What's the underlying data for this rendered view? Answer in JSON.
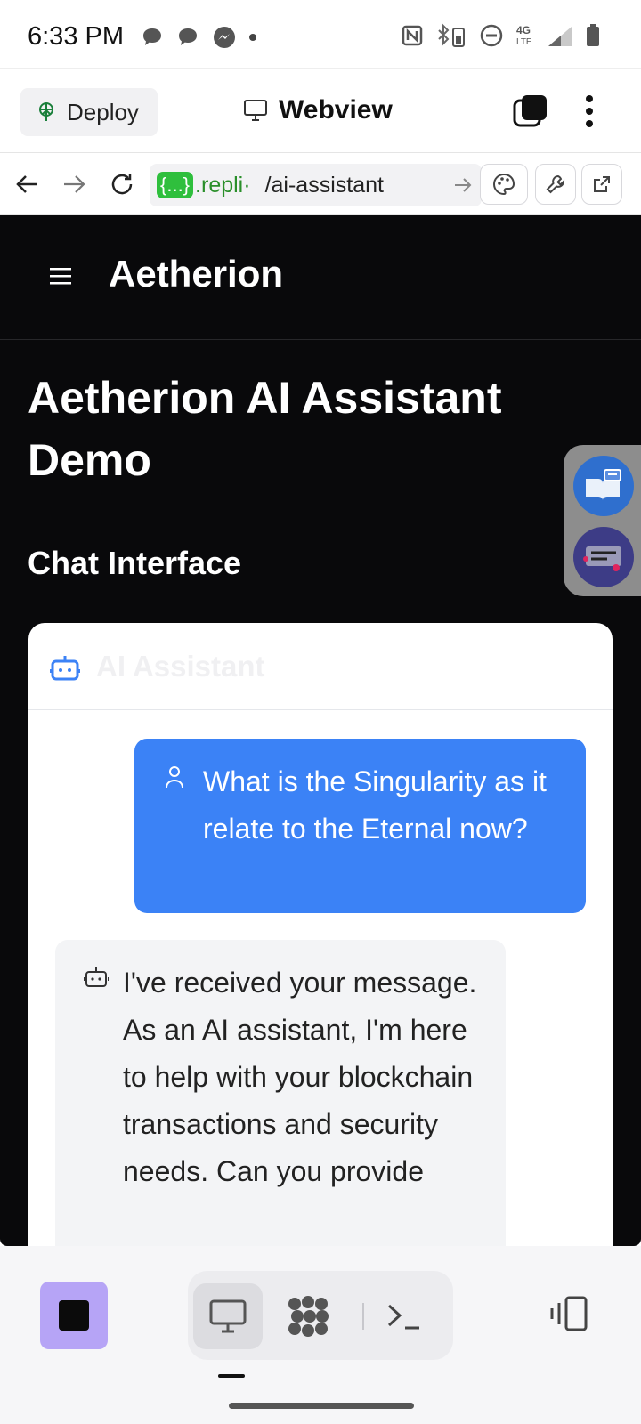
{
  "status_bar": {
    "time": "6:33 PM",
    "icons_left": [
      "chat-bubble-icon",
      "chat-bubble-icon",
      "messenger-icon",
      "dot"
    ],
    "icons_right": [
      "nfc-icon",
      "bluetooth-battery-icon",
      "do-not-disturb-icon",
      "4g-lte-signal-icon",
      "battery-icon"
    ],
    "network_label": "4G LTE"
  },
  "top_bar": {
    "deploy_label": "Deploy",
    "webview_label": "Webview"
  },
  "url_bar": {
    "chip": "{...}",
    "host": ".repli·",
    "path": "/ai-assistant"
  },
  "app": {
    "name": "Aetherion",
    "page_title": "Aetherion AI Assistant Demo",
    "section_title": "Chat Interface",
    "chat": {
      "header_title": "AI Assistant",
      "messages": [
        {
          "role": "user",
          "text": "What is the Singularity as it relate to the Eternal now?"
        },
        {
          "role": "assistant",
          "text": "I've received your message. As an AI assistant, I'm here to help with your blockchain transactions and security needs. Can you provide"
        }
      ]
    }
  },
  "colors": {
    "accent_blue": "#3b82f6",
    "dark_bg": "#09090b",
    "stop_button": "#b6a4f6",
    "url_chip_green": "#2fbf3d"
  }
}
